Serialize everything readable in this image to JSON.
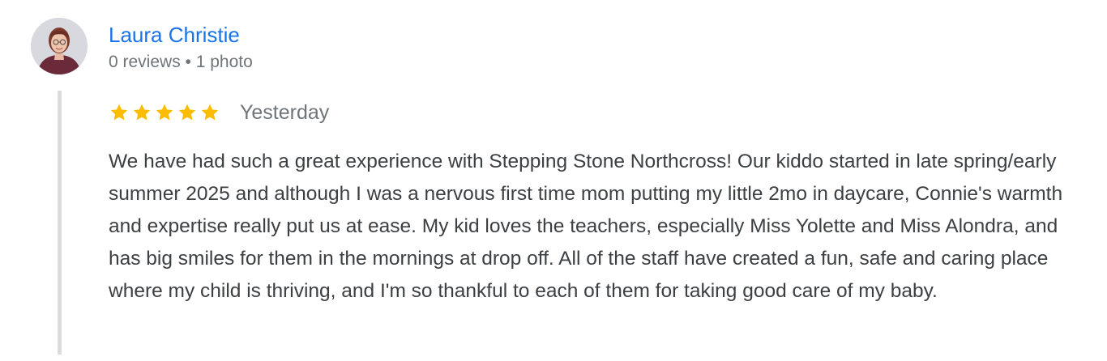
{
  "reviewer": {
    "name": "Laura Christie",
    "meta": "0 reviews • 1 photo",
    "avatar_icon": "person-avatar-icon"
  },
  "rating": {
    "stars": 5,
    "max_stars": 5,
    "star_color": "#fbbc04",
    "date": "Yesterday"
  },
  "review": {
    "text": "We have had such a great experience with Stepping Stone Northcross! Our kiddo started in late spring/early summer 2025 and although I was a nervous first time mom putting my little 2mo in daycare, Connie's warmth and expertise really put us at ease. My kid loves the teachers, especially Miss Yolette and Miss Alondra, and has big smiles for them in the mornings at drop off. All of the staff have created a fun, safe and caring place where my child is thriving, and I'm so thankful to each of them for taking good care of my baby."
  },
  "colors": {
    "name_link": "#1a73e8",
    "meta_text": "#70757a",
    "body_text": "#3c4043",
    "thread_line": "#dadce0"
  }
}
